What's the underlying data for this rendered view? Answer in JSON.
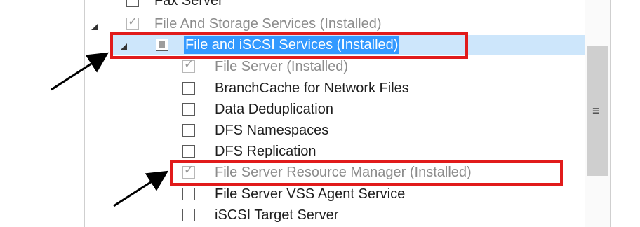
{
  "tree": {
    "items": [
      {
        "label": "Fax Server",
        "checked": false,
        "enabled": true
      },
      {
        "label": "File And Storage Services (Installed)",
        "checked": true,
        "enabled": false,
        "expanded": true
      },
      {
        "label": "File and iSCSI Services (Installed)",
        "state": "partial",
        "enabled": true,
        "expanded": true,
        "selected": true
      },
      {
        "label": "File Server (Installed)",
        "checked": true,
        "enabled": false
      },
      {
        "label": "BranchCache for Network Files",
        "checked": false,
        "enabled": true
      },
      {
        "label": "Data Deduplication",
        "checked": false,
        "enabled": true
      },
      {
        "label": "DFS Namespaces",
        "checked": false,
        "enabled": true
      },
      {
        "label": "DFS Replication",
        "checked": false,
        "enabled": true
      },
      {
        "label": "File Server Resource Manager (Installed)",
        "checked": true,
        "enabled": false
      },
      {
        "label": "File Server VSS Agent Service",
        "checked": false,
        "enabled": true
      },
      {
        "label": "iSCSI Target Server",
        "checked": false,
        "enabled": true
      }
    ]
  },
  "scrollbar": {
    "grip_glyph": "≡"
  },
  "colors": {
    "selection": "#3399ff",
    "annotation_box": "#e11b1b",
    "arrow": "#000000"
  }
}
